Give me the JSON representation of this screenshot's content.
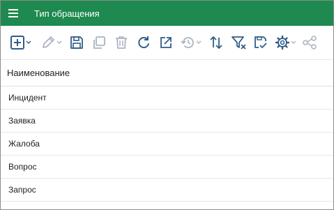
{
  "window": {
    "title": "Тип обращения"
  },
  "colors": {
    "header_bg": "#1e8a4f",
    "icon_active": "#2f5d87",
    "icon_disabled": "#aab4c0"
  },
  "toolbar": {
    "icons": [
      "add-icon",
      "edit-icon",
      "save-icon",
      "copy-icon",
      "delete-icon",
      "refresh-icon",
      "export-icon",
      "history-icon",
      "sort-icon",
      "filter-clear-icon",
      "save-filter-icon",
      "settings-icon",
      "hierarchy-icon"
    ]
  },
  "table": {
    "column_header": "Наименование",
    "rows": [
      "Инцидент",
      "Заявка",
      "Жалоба",
      "Вопрос",
      "Запрос"
    ]
  }
}
